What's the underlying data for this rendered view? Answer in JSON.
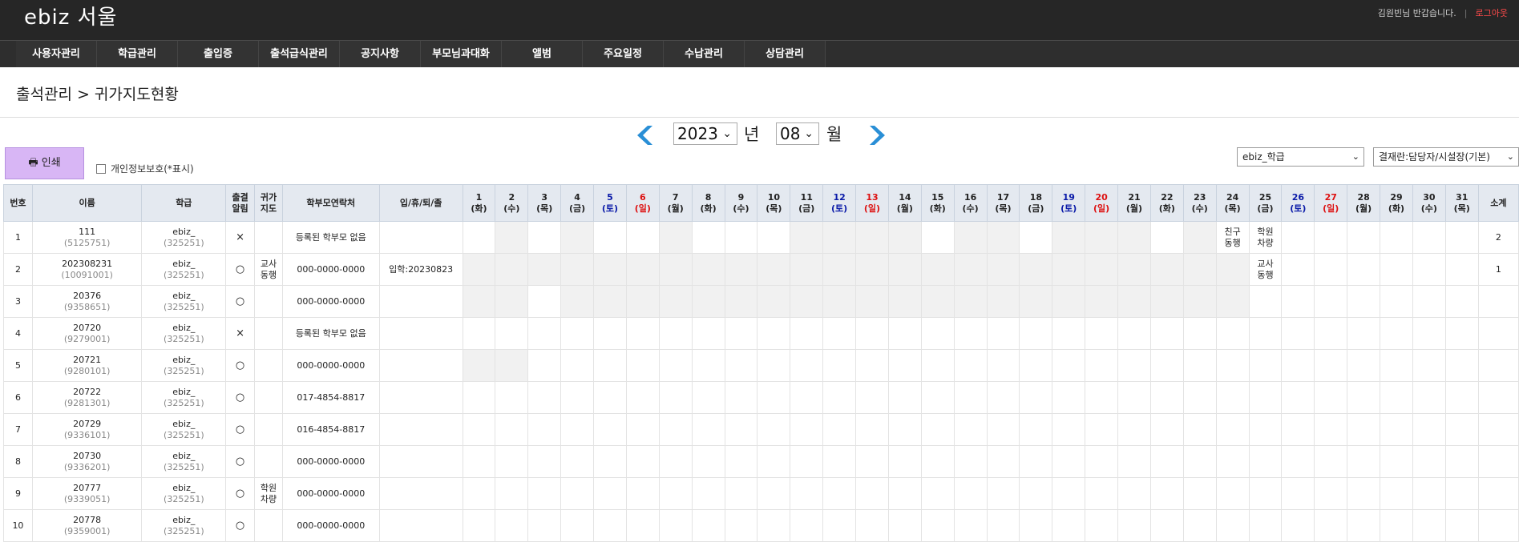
{
  "header": {
    "logo": "ebiz 서울",
    "welcome": "김원빈님 반갑습니다.",
    "separator": "|",
    "logout": "로그아웃"
  },
  "menu": [
    "사용자관리",
    "학급관리",
    "출입증",
    "출석급식관리",
    "공지사항",
    "부모님과대화",
    "앨범",
    "주요일정",
    "수납관리",
    "상담관리"
  ],
  "breadcrumb": "출석관리 > 귀가지도현황",
  "date_nav": {
    "year": "2023",
    "year_label": "년",
    "month": "08",
    "month_label": "월"
  },
  "toolbar": {
    "print_label": "인쇄",
    "privacy_label": "개인정보보호(*표시)",
    "class_select": "ebiz_학급",
    "approval_select": "결재란:담당자/시설장(기본)"
  },
  "table": {
    "headers": {
      "no": "번호",
      "name": "이름",
      "class": "학급",
      "notify": "출결\n알림",
      "guide": "귀가\n지도",
      "contact": "학부모연락처",
      "status": "입/휴/퇴/졸",
      "total": "소계"
    },
    "days": [
      {
        "d": "1",
        "w": "(화)"
      },
      {
        "d": "2",
        "w": "(수)"
      },
      {
        "d": "3",
        "w": "(목)"
      },
      {
        "d": "4",
        "w": "(금)"
      },
      {
        "d": "5",
        "w": "(토)"
      },
      {
        "d": "6",
        "w": "(일)"
      },
      {
        "d": "7",
        "w": "(월)"
      },
      {
        "d": "8",
        "w": "(화)"
      },
      {
        "d": "9",
        "w": "(수)"
      },
      {
        "d": "10",
        "w": "(목)"
      },
      {
        "d": "11",
        "w": "(금)"
      },
      {
        "d": "12",
        "w": "(토)"
      },
      {
        "d": "13",
        "w": "(일)"
      },
      {
        "d": "14",
        "w": "(월)"
      },
      {
        "d": "15",
        "w": "(화)"
      },
      {
        "d": "16",
        "w": "(수)"
      },
      {
        "d": "17",
        "w": "(목)"
      },
      {
        "d": "18",
        "w": "(금)"
      },
      {
        "d": "19",
        "w": "(토)"
      },
      {
        "d": "20",
        "w": "(일)"
      },
      {
        "d": "21",
        "w": "(월)"
      },
      {
        "d": "22",
        "w": "(화)"
      },
      {
        "d": "23",
        "w": "(수)"
      },
      {
        "d": "24",
        "w": "(목)"
      },
      {
        "d": "25",
        "w": "(금)"
      },
      {
        "d": "26",
        "w": "(토)"
      },
      {
        "d": "27",
        "w": "(일)"
      },
      {
        "d": "28",
        "w": "(월)"
      },
      {
        "d": "29",
        "w": "(화)"
      },
      {
        "d": "30",
        "w": "(수)"
      },
      {
        "d": "31",
        "w": "(목)"
      }
    ],
    "rows": [
      {
        "no": "1",
        "name": "111",
        "id": "(5125751)",
        "class": "ebiz_",
        "class_id": "(325251)",
        "notify": "×",
        "guide": "",
        "contact": "등록된 학부모 없음",
        "status": "",
        "entries": {
          "24": "친구\n동행",
          "25": "학원\n차량"
        },
        "total": "2"
      },
      {
        "no": "2",
        "name": "202308231",
        "id": "(10091001)",
        "class": "ebiz_",
        "class_id": "(325251)",
        "notify": "○",
        "guide": "교사\n동행",
        "contact": "000-0000-0000",
        "status": "입학:20230823",
        "entries": {
          "25": "교사\n동행"
        },
        "total": "1"
      },
      {
        "no": "3",
        "name": "20376",
        "id": "(9358651)",
        "class": "ebiz_",
        "class_id": "(325251)",
        "notify": "○",
        "guide": "",
        "contact": "000-0000-0000",
        "status": "",
        "entries": {},
        "total": ""
      },
      {
        "no": "4",
        "name": "20720",
        "id": "(9279001)",
        "class": "ebiz_",
        "class_id": "(325251)",
        "notify": "×",
        "guide": "",
        "contact": "등록된 학부모 없음",
        "status": "",
        "entries": {},
        "total": ""
      },
      {
        "no": "5",
        "name": "20721",
        "id": "(9280101)",
        "class": "ebiz_",
        "class_id": "(325251)",
        "notify": "○",
        "guide": "",
        "contact": "000-0000-0000",
        "status": "",
        "entries": {},
        "total": ""
      },
      {
        "no": "6",
        "name": "20722",
        "id": "(9281301)",
        "class": "ebiz_",
        "class_id": "(325251)",
        "notify": "○",
        "guide": "",
        "contact": "017-4854-8817",
        "status": "",
        "entries": {},
        "total": ""
      },
      {
        "no": "7",
        "name": "20729",
        "id": "(9336101)",
        "class": "ebiz_",
        "class_id": "(325251)",
        "notify": "○",
        "guide": "",
        "contact": "016-4854-8817",
        "status": "",
        "entries": {},
        "total": ""
      },
      {
        "no": "8",
        "name": "20730",
        "id": "(9336201)",
        "class": "ebiz_",
        "class_id": "(325251)",
        "notify": "○",
        "guide": "",
        "contact": "000-0000-0000",
        "status": "",
        "entries": {},
        "total": ""
      },
      {
        "no": "9",
        "name": "20777",
        "id": "(9339051)",
        "class": "ebiz_",
        "class_id": "(325251)",
        "notify": "○",
        "guide": "학원\n차량",
        "contact": "000-0000-0000",
        "status": "",
        "entries": {},
        "total": ""
      },
      {
        "no": "10",
        "name": "20778",
        "id": "(9359001)",
        "class": "ebiz_",
        "class_id": "(325251)",
        "notify": "○",
        "guide": "",
        "contact": "000-0000-0000",
        "status": "",
        "entries": {},
        "total": ""
      }
    ]
  },
  "colors": {
    "topbar": "#262626",
    "menubar": "#2e2e2e",
    "print_button": "#d8b6f5",
    "saturday": "#0a1aa8",
    "sunday": "#dd1111",
    "arrow": "#2a8fd6",
    "header_cell": "#e4e9f0"
  },
  "icons": {
    "prev_month": "chevron-left-icon",
    "next_month": "chevron-right-icon",
    "print": "printer-icon"
  }
}
